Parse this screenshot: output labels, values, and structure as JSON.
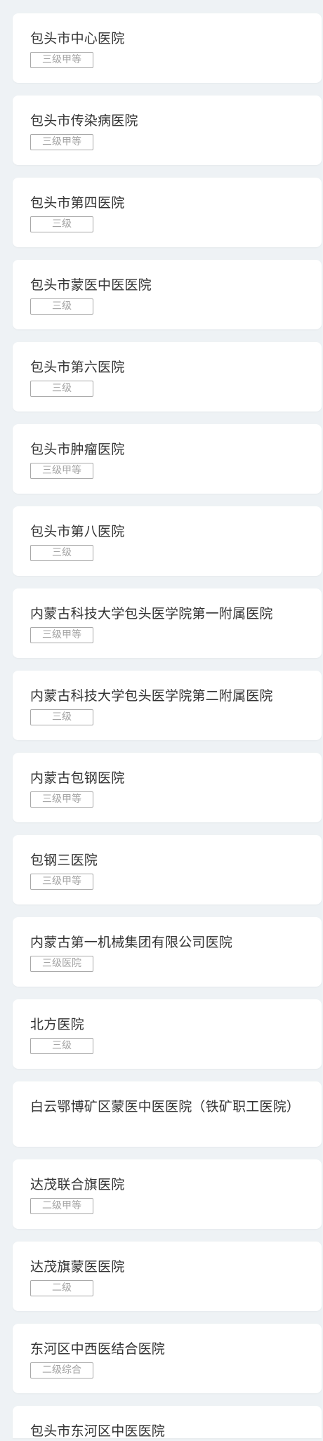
{
  "hospitals": [
    {
      "name": "包头市中心医院",
      "level": "三级甲等"
    },
    {
      "name": "包头市传染病医院",
      "level": "三级甲等"
    },
    {
      "name": "包头市第四医院",
      "level": "三级"
    },
    {
      "name": "包头市蒙医中医医院",
      "level": "三级"
    },
    {
      "name": "包头市第六医院",
      "level": "三级"
    },
    {
      "name": "包头市肿瘤医院",
      "level": "三级甲等"
    },
    {
      "name": "包头市第八医院",
      "level": "三级"
    },
    {
      "name": "内蒙古科技大学包头医学院第一附属医院",
      "level": "三级甲等"
    },
    {
      "name": "内蒙古科技大学包头医学院第二附属医院",
      "level": "三级"
    },
    {
      "name": "内蒙古包钢医院",
      "level": "三级甲等"
    },
    {
      "name": "包钢三医院",
      "level": "三级甲等"
    },
    {
      "name": "内蒙古第一机械集团有限公司医院",
      "level": "三级医院"
    },
    {
      "name": "北方医院",
      "level": "三级"
    },
    {
      "name": "白云鄂博矿区蒙医中医医院（铁矿职工医院）",
      "level": ""
    },
    {
      "name": "达茂联合旗医院",
      "level": "二级甲等"
    },
    {
      "name": "达茂旗蒙医医院",
      "level": "二级"
    },
    {
      "name": "东河区中西医结合医院",
      "level": "二级综合"
    },
    {
      "name": "包头市东河区中医医院",
      "level": ""
    }
  ]
}
